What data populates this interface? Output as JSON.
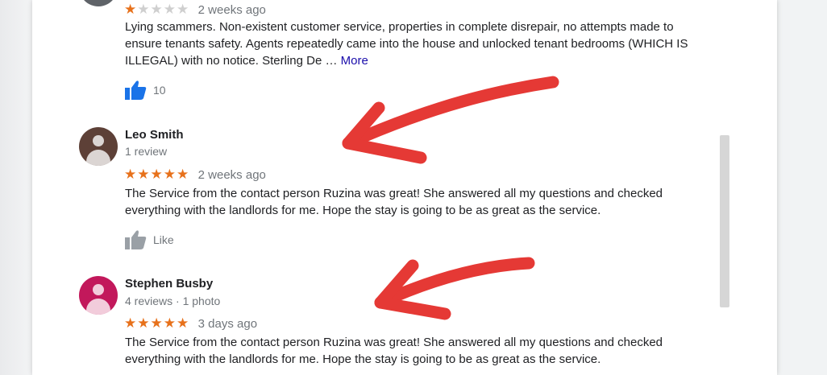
{
  "reviews": [
    {
      "rating": 1,
      "time": "2 weeks ago",
      "text": "Lying scammers. Non-existent customer service, properties in complete disrepair, no attempts made to ensure tenants safety. Agents repeatedly came into the house and unlocked tenant bedrooms (WHICH IS ILLEGAL) with no notice. Sterling De … ",
      "more_label": "More",
      "like_count": "10",
      "like_color": "#1a73e8"
    },
    {
      "name": "Leo Smith",
      "meta": "1 review",
      "avatar_color": "#5d4037",
      "rating": 5,
      "time": "2 weeks ago",
      "text": "The Service from the contact person Ruzina was great! She answered all my questions and checked everything with the landlords for me. Hope the stay is going to be as great as the service.",
      "like_label": "Like",
      "like_color": "#9aa0a6"
    },
    {
      "name": "Stephen Busby",
      "meta": "4 reviews · 1 photo",
      "avatar_color": "#c2185b",
      "rating": 5,
      "time": "3 days ago",
      "text": "The Service from the contact person Ruzina was great! She answered all my questions and checked everything with the landlords for me. Hope the stay is going to be as great as the service."
    }
  ],
  "annotation": {
    "arrow_color": "#e53935"
  },
  "colors": {
    "star": "#e7711b",
    "link": "#1a0dab"
  }
}
